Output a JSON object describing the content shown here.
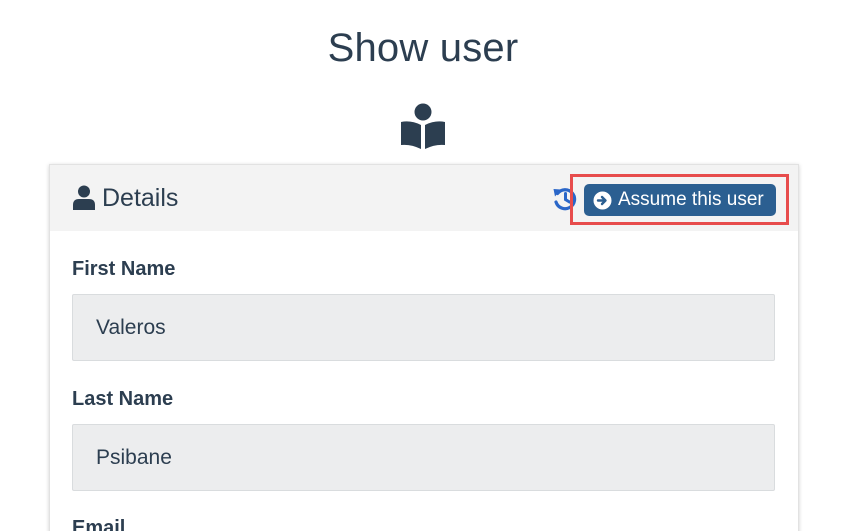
{
  "page": {
    "title": "Show user",
    "icon": "book-reader-icon"
  },
  "card": {
    "title": "Details",
    "header_icon": "user-icon",
    "history_icon": "history-icon",
    "assume_button": {
      "label": "Assume this user",
      "icon": "arrow-circle-right-icon"
    }
  },
  "fields": [
    {
      "label": "First Name",
      "value": "Valeros"
    },
    {
      "label": "Last Name",
      "value": "Psibane"
    },
    {
      "label": "Email",
      "value": ""
    }
  ],
  "colors": {
    "text": "#2c3e50",
    "header_bg": "#f3f3f3",
    "button_bg": "#2b5f91",
    "highlight": "#e74c4c",
    "history_icon": "#2a66c8",
    "input_bg": "#ecedee"
  }
}
